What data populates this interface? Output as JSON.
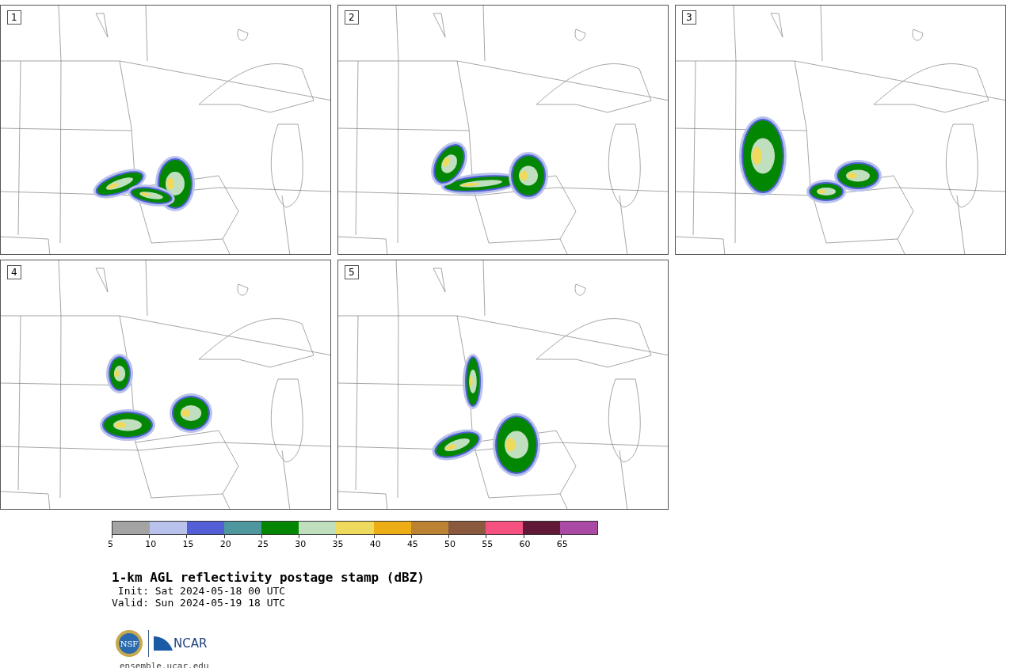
{
  "panels": [
    {
      "label": "1"
    },
    {
      "label": "2"
    },
    {
      "label": "3"
    },
    {
      "label": "4"
    },
    {
      "label": "5"
    }
  ],
  "colorbar": {
    "segments": [
      {
        "color": "#a4a4a4"
      },
      {
        "color": "#b8c2ec"
      },
      {
        "color": "#535fd6"
      },
      {
        "color": "#4f979e"
      },
      {
        "color": "#038703"
      },
      {
        "color": "#bfdfbf"
      },
      {
        "color": "#f0da5d"
      },
      {
        "color": "#edad16"
      },
      {
        "color": "#ba8232"
      },
      {
        "color": "#8b5a3e"
      },
      {
        "color": "#f55281"
      },
      {
        "color": "#621937"
      },
      {
        "color": "#aa4aa4"
      }
    ],
    "ticks": [
      "5",
      "10",
      "15",
      "20",
      "25",
      "30",
      "35",
      "40",
      "45",
      "50",
      "55",
      "60",
      "65"
    ]
  },
  "title": "1-km AGL reflectivity postage stamp (dBZ)",
  "init": " Init: Sat 2024-05-18 00 UTC",
  "valid": "Valid: Sun 2024-05-19 18 UTC",
  "nsf_logo": "NSF",
  "ncar_logo": "NCAR",
  "footer": "ensemble.ucar.edu"
}
